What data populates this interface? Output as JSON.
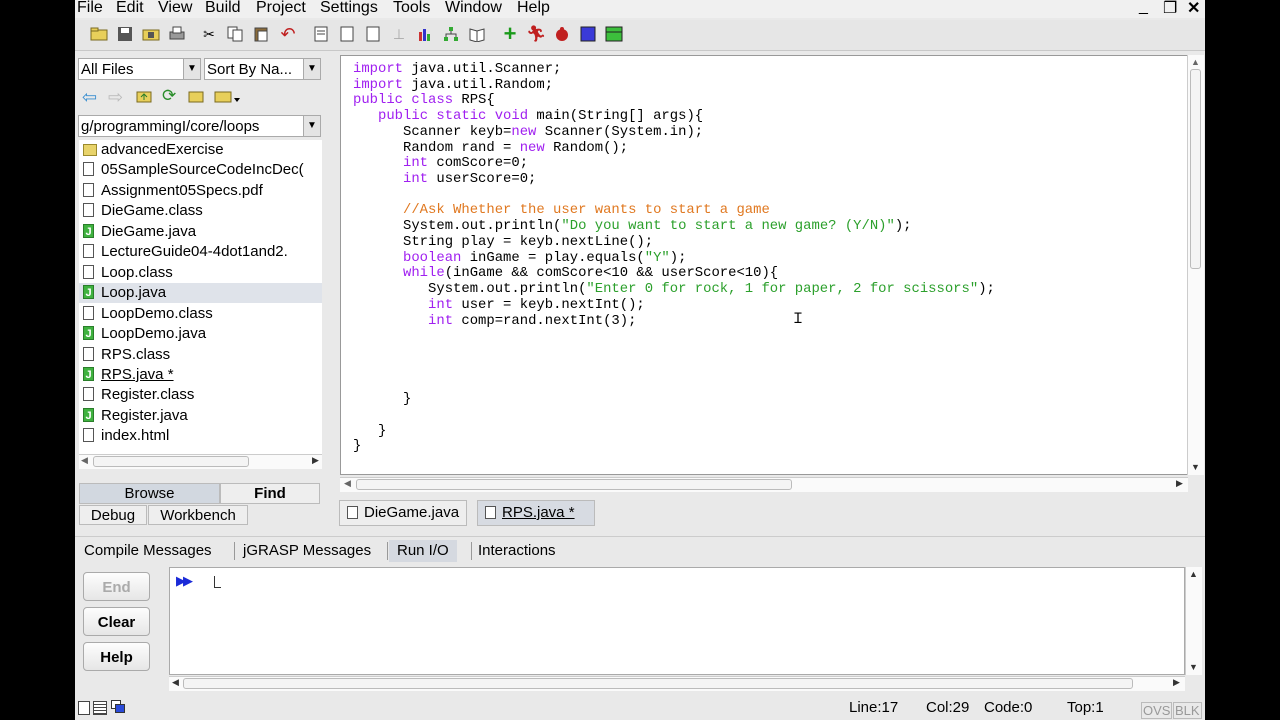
{
  "menu": [
    "File",
    "Edit",
    "View",
    "Build",
    "Project",
    "Settings",
    "Tools",
    "Window",
    "Help"
  ],
  "window_controls": [
    "_",
    "❐",
    "✕"
  ],
  "toolbar_icons": [
    "open-folder-icon",
    "save-icon",
    "save-all-icon",
    "print-icon",
    "cut-icon",
    "copy-icon",
    "paste-icon",
    "undo-icon",
    "new-file-icon",
    "file-icon",
    "file2-icon",
    "pin-icon",
    "chart-icon",
    "tree-icon",
    "book-icon",
    "add-icon",
    "run-icon",
    "debug-icon",
    "stop-icon",
    "square-icon"
  ],
  "browser": {
    "filter": "All Files",
    "sort": "Sort By Na...",
    "path": "g/programmingI/core/loops",
    "files": [
      {
        "name": "advancedExercise",
        "type": "folder"
      },
      {
        "name": "05SampleSourceCodeIncDec(",
        "type": "file"
      },
      {
        "name": "Assignment05Specs.pdf",
        "type": "file"
      },
      {
        "name": "DieGame.class",
        "type": "file"
      },
      {
        "name": "DieGame.java",
        "type": "java"
      },
      {
        "name": "LectureGuide04-4dot1and2.",
        "type": "file"
      },
      {
        "name": "Loop.class",
        "type": "file"
      },
      {
        "name": "Loop.java",
        "type": "java",
        "selected": true
      },
      {
        "name": "LoopDemo.class",
        "type": "file"
      },
      {
        "name": "LoopDemo.java",
        "type": "java"
      },
      {
        "name": "RPS.class",
        "type": "file"
      },
      {
        "name": "RPS.java *",
        "type": "java"
      },
      {
        "name": "Register.class",
        "type": "file"
      },
      {
        "name": "Register.java",
        "type": "java"
      },
      {
        "name": "index.html",
        "type": "file"
      }
    ],
    "tabs": [
      "Browse",
      "Find",
      "Debug",
      "Workbench"
    ]
  },
  "editor": {
    "code_lines": [
      [
        [
          "kw",
          "import"
        ],
        [
          "",
          " java.util.Scanner;"
        ]
      ],
      [
        [
          "kw",
          "import"
        ],
        [
          "",
          " java.util.Random;"
        ]
      ],
      [
        [
          "kw",
          "public class"
        ],
        [
          "",
          " RPS{"
        ]
      ],
      [
        [
          "",
          "   "
        ],
        [
          "kw",
          "public static void"
        ],
        [
          "",
          " main(String[] args){"
        ]
      ],
      [
        [
          "",
          "      Scanner keyb="
        ],
        [
          "kw",
          "new"
        ],
        [
          "",
          " Scanner(System.in);"
        ]
      ],
      [
        [
          "",
          "      Random rand = "
        ],
        [
          "kw",
          "new"
        ],
        [
          "",
          " Random();"
        ]
      ],
      [
        [
          "",
          "      "
        ],
        [
          "kw",
          "int"
        ],
        [
          "",
          " comScore=0;"
        ]
      ],
      [
        [
          "",
          "      "
        ],
        [
          "kw",
          "int"
        ],
        [
          "",
          " userScore=0;"
        ]
      ],
      [
        [
          "",
          ""
        ]
      ],
      [
        [
          "",
          "      "
        ],
        [
          "cm",
          "//Ask Whether the user wants to start a game"
        ]
      ],
      [
        [
          "",
          "      System.out.println("
        ],
        [
          "str",
          "\"Do you want to start a new game? (Y/N)\""
        ],
        [
          "",
          ");"
        ]
      ],
      [
        [
          "",
          "      String play = keyb.nextLine();"
        ]
      ],
      [
        [
          "",
          "      "
        ],
        [
          "kw",
          "boolean"
        ],
        [
          "",
          " inGame = play.equals("
        ],
        [
          "str",
          "\"Y\""
        ],
        [
          "",
          ");"
        ]
      ],
      [
        [
          "",
          "      "
        ],
        [
          "kw",
          "while"
        ],
        [
          "",
          "(inGame && comScore<10 && userScore<10){"
        ]
      ],
      [
        [
          "",
          "         System.out.println("
        ],
        [
          "str",
          "\"Enter 0 for rock, 1 for paper, 2 for scissors\""
        ],
        [
          "",
          ");"
        ]
      ],
      [
        [
          "",
          "         "
        ],
        [
          "kw",
          "int"
        ],
        [
          "",
          " user = keyb.nextInt();"
        ]
      ],
      [
        [
          "",
          "         "
        ],
        [
          "kw",
          "int"
        ],
        [
          "",
          " comp=rand.nextInt(3);"
        ]
      ],
      [
        [
          "",
          ""
        ]
      ],
      [
        [
          "",
          ""
        ]
      ],
      [
        [
          "",
          ""
        ]
      ],
      [
        [
          "",
          ""
        ]
      ],
      [
        [
          "",
          "      }"
        ]
      ],
      [
        [
          "",
          ""
        ]
      ],
      [
        [
          "",
          "   }"
        ]
      ],
      [
        [
          "",
          "}"
        ]
      ]
    ],
    "tabs": [
      "DieGame.java",
      "RPS.java *"
    ]
  },
  "messages": {
    "tabs": [
      "Compile Messages",
      "jGRASP Messages",
      "Run I/O",
      "Interactions"
    ],
    "buttons": [
      "End",
      "Clear",
      "Help"
    ],
    "prompt": "▶▶"
  },
  "status": {
    "line": "Line:17",
    "col": "Col:29",
    "code": "Code:0",
    "top": "Top:1",
    "ovs": "OVS",
    "blk": "BLK"
  }
}
